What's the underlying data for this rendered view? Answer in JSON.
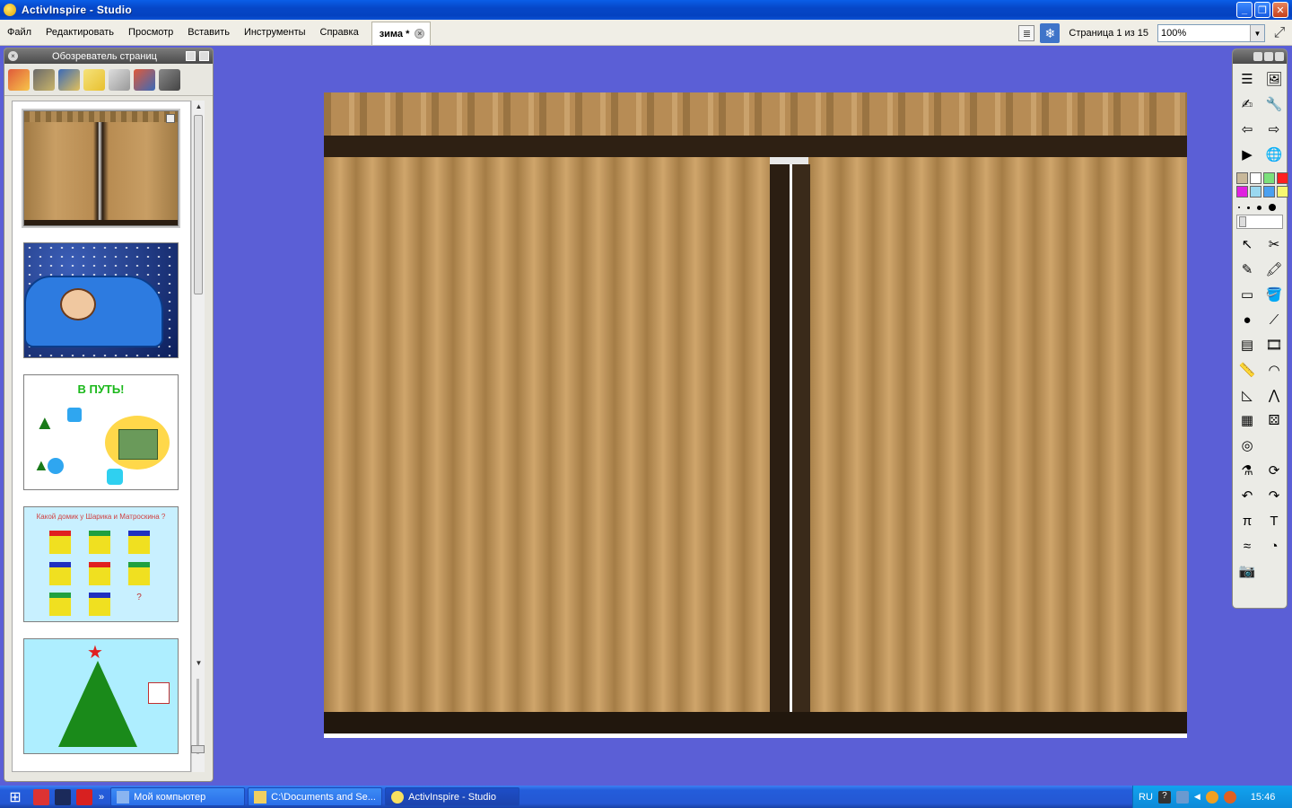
{
  "window": {
    "title": "ActivInspire - Studio"
  },
  "menu": {
    "items": [
      "Файл",
      "Редактировать",
      "Просмотр",
      "Вставить",
      "Инструменты",
      "Справка"
    ]
  },
  "doc_tab": {
    "label": "зима *"
  },
  "page_info": {
    "label": "Страница 1 из 15"
  },
  "zoom": {
    "value": "100%"
  },
  "page_browser": {
    "title": "Обозреватель страниц",
    "thumbnails": [
      {
        "title": ""
      },
      {
        "title": ""
      },
      {
        "title": "В ПУТЬ!"
      },
      {
        "title": "Какой домик у Шарика и Матроскина ?"
      },
      {
        "title": ""
      }
    ]
  },
  "toolbox": {
    "palette": [
      "#c8b89a",
      "#ffffff",
      "#7be07b",
      "#ff2020",
      "#e020e0",
      "#9ad8f0",
      "#4aa0f0",
      "#f8f870"
    ]
  },
  "taskbar": {
    "tasks": [
      {
        "label": "Мой компьютер",
        "active": false
      },
      {
        "label": "C:\\Documents and Se...",
        "active": false
      },
      {
        "label": "ActivInspire - Studio",
        "active": true
      }
    ],
    "language": "RU",
    "clock": "15:46"
  },
  "colors": {
    "workspace": "#5b5fd6",
    "curtain": "#c49a62",
    "curtain_dark": "#2b1e12"
  }
}
